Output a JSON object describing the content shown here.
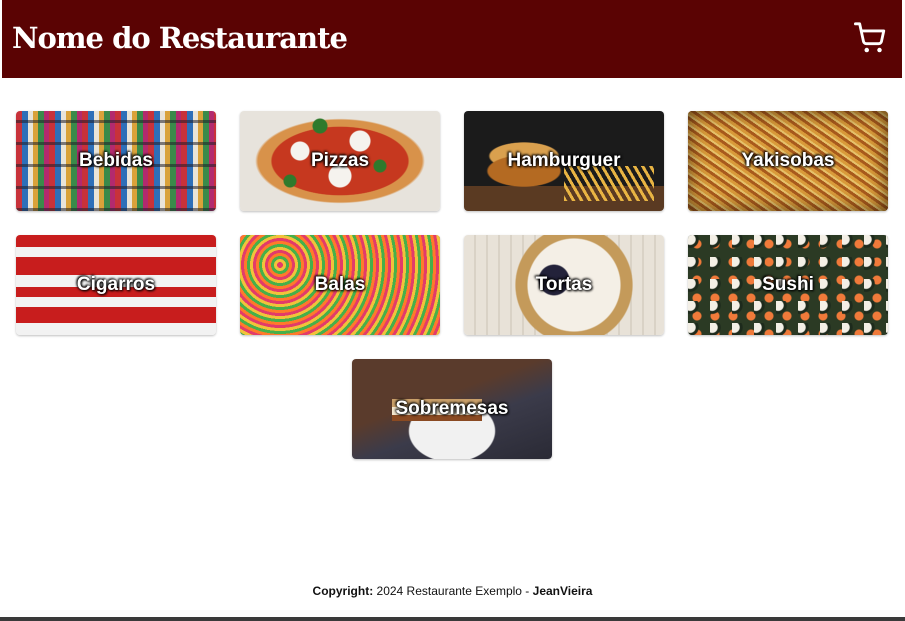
{
  "header": {
    "title": "Nome do Restaurante",
    "cart_icon": "cart-icon",
    "background": "#5a0303"
  },
  "categories": [
    {
      "label": "Bebidas"
    },
    {
      "label": "Pizzas"
    },
    {
      "label": "Hamburguer"
    },
    {
      "label": "Yakisobas"
    },
    {
      "label": "Cigarros"
    },
    {
      "label": "Balas"
    },
    {
      "label": "Tortas"
    },
    {
      "label": "Sushi"
    },
    {
      "label": "Sobremesas"
    }
  ],
  "footer": {
    "copyright_label": "Copyright:",
    "text": "2024 Restaurante Exemplo -",
    "author": "JeanVieira"
  }
}
